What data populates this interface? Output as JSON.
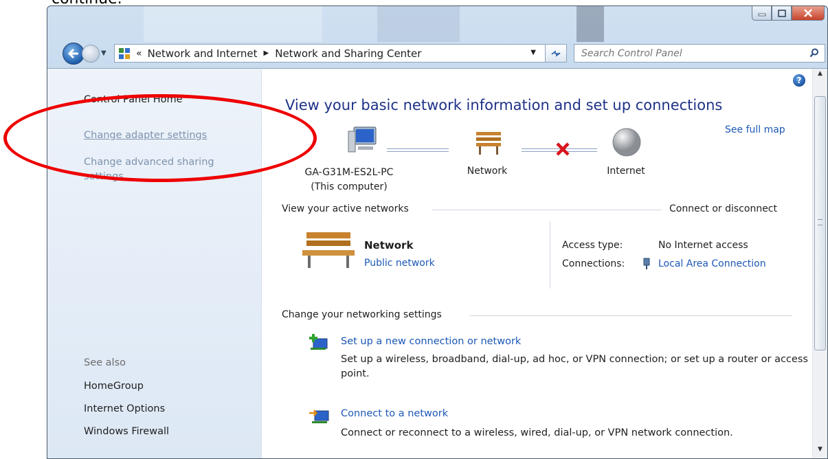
{
  "top_cut_text": "continue.",
  "address": {
    "overflow": "«",
    "crumbs": [
      "Network and Internet",
      "Network and Sharing Center"
    ]
  },
  "search": {
    "placeholder": "Search Control Panel"
  },
  "left_pane": {
    "home": "Control Panel Home",
    "links": [
      "Change adapter settings",
      "Change advanced sharing settings"
    ],
    "see_also_title": "See also",
    "see_also": [
      "HomeGroup",
      "Internet Options",
      "Windows Firewall"
    ]
  },
  "main": {
    "heading": "View your basic network information and set up connections",
    "see_full_map": "See full map",
    "map": {
      "computer_name": "GA-G31M-ES2L-PC",
      "computer_sub": "(This computer)",
      "network": "Network",
      "internet": "Internet"
    },
    "active_networks": {
      "title": "View your active networks",
      "action": "Connect or disconnect",
      "network_name": "Network",
      "network_type": "Public network",
      "access_type_label": "Access type:",
      "access_type_value": "No Internet access",
      "connections_label": "Connections:",
      "connections_value": "Local Area Connection"
    },
    "change_settings": {
      "title": "Change your networking settings",
      "tasks": [
        {
          "title": "Set up a new connection or network",
          "desc": "Set up a wireless, broadband, dial-up, ad hoc, or VPN connection; or set up a router or access point."
        },
        {
          "title": "Connect to a network",
          "desc": "Connect or reconnect to a wireless, wired, dial-up, or VPN network connection."
        }
      ]
    }
  },
  "icons": {
    "back": "back-arrow-icon",
    "forward": "forward-arrow-icon",
    "refresh": "refresh-icon",
    "search": "search-icon",
    "help": "help-icon",
    "computer": "computer-icon",
    "bench": "network-bench-icon",
    "broken": "disconnected-x-icon",
    "globe": "internet-globe-icon"
  },
  "colors": {
    "link": "#1c58b5",
    "heading": "#1e3287",
    "highlight_ellipse": "#ee0000"
  }
}
